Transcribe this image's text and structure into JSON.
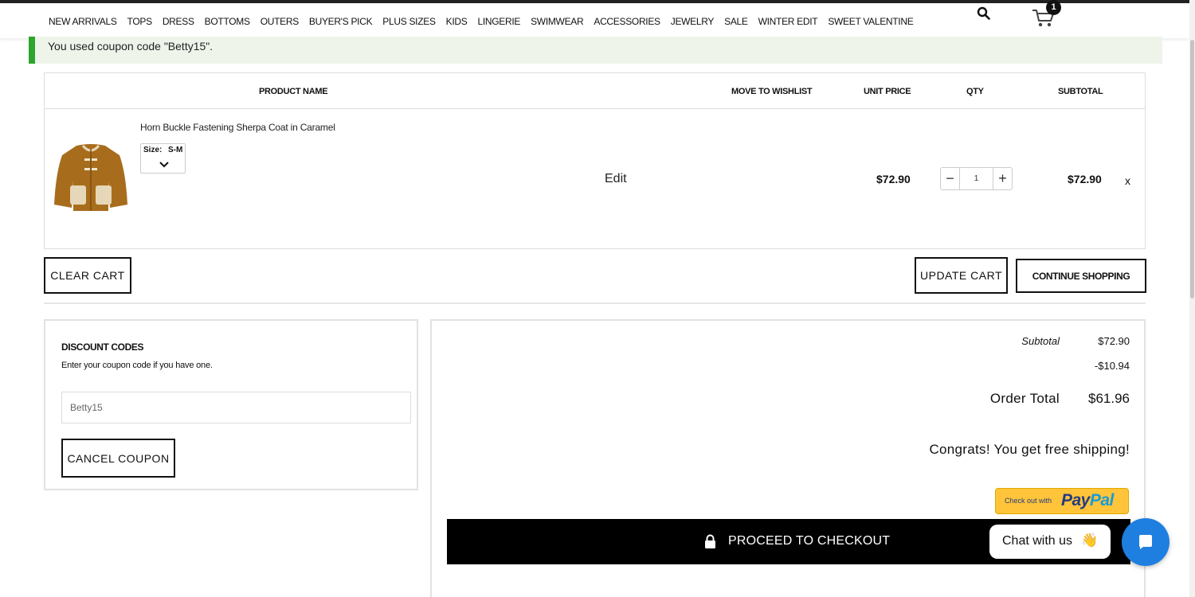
{
  "nav": {
    "items": [
      "NEW ARRIVALS",
      "TOPS",
      "DRESS",
      "BOTTOMS",
      "OUTERS",
      "BUYER'S PICK",
      "PLUS SIZES",
      "KIDS",
      "LINGERIE",
      "SWIMWEAR",
      "ACCESSORIES",
      "JEWELRY",
      "SALE",
      "WINTER EDIT",
      "SWEET VALENTINE"
    ]
  },
  "header": {
    "search_icon": "search-icon",
    "cart_icon": "cart-icon",
    "cart_count": "1"
  },
  "notice": {
    "message": "You used coupon code \"Betty15\"."
  },
  "cart": {
    "columns": {
      "product_name": "PRODUCT NAME",
      "move_to_wishlist": "MOVE TO WISHLIST",
      "unit_price": "UNIT PRICE",
      "qty": "QTY",
      "subtotal": "SUBTOTAL"
    },
    "items": [
      {
        "name": "Horn Buckle Fastening Sherpa Coat in Caramel",
        "size_label": "Size:",
        "size_value": "S-M",
        "edit_label": "Edit",
        "unit_price": "$72.90",
        "qty": "1",
        "subtotal": "$72.90",
        "remove_label": "x"
      }
    ]
  },
  "actions": {
    "clear_cart": "CLEAR CART",
    "update_cart": "UPDATE CART",
    "continue_shopping": "CONTINUE SHOPPING"
  },
  "discount": {
    "title": "DISCOUNT CODES",
    "help": "Enter your coupon code if you have one.",
    "code_value": "Betty15",
    "cancel_label": "CANCEL COUPON"
  },
  "summary": {
    "subtotal_label": "Subtotal",
    "subtotal_value": "$72.90",
    "discount_value": "-$10.94",
    "order_total_label": "Order Total",
    "order_total_value": "$61.96",
    "shipping_message": "Congrats! You get free shipping!",
    "paypal_prefix": "Check out with",
    "paypal_pay": "Pay",
    "paypal_pal": "Pal",
    "checkout_label": "PROCEED TO CHECKOUT"
  },
  "chat": {
    "label": "Chat with us",
    "wave": "👋"
  },
  "colors": {
    "notice_bg": "#eef4ea",
    "notice_accent": "#2ea52e",
    "paypal_yellow": "#ffc439",
    "chat_blue": "#1f7fe0",
    "coat_caramel": "#a86d1c"
  }
}
